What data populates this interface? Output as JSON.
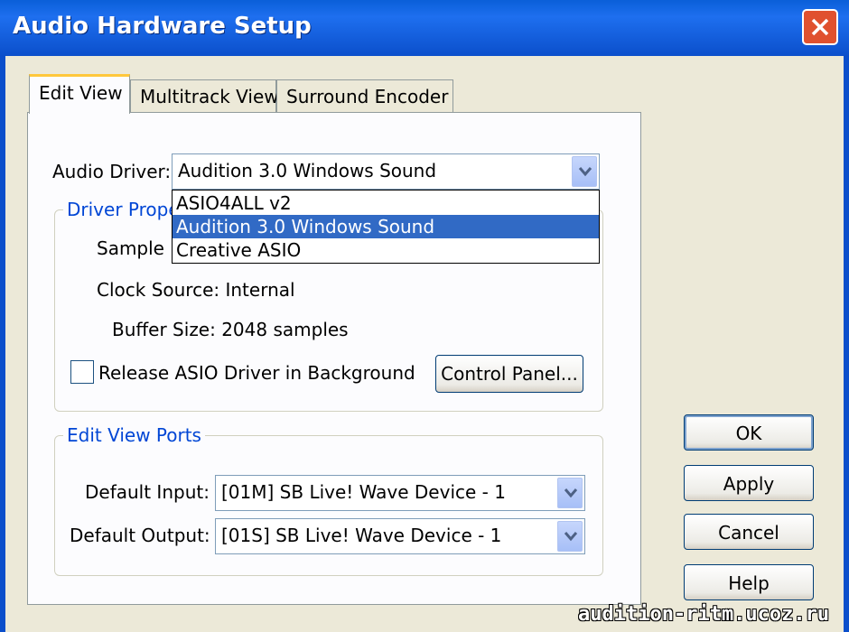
{
  "window": {
    "title": "Audio Hardware Setup"
  },
  "tabs": [
    {
      "label": "Edit View",
      "active": true
    },
    {
      "label": "Multitrack View",
      "active": false
    },
    {
      "label": "Surround Encoder",
      "active": false
    }
  ],
  "audio_driver": {
    "label": "Audio Driver:",
    "value": "Audition 3.0 Windows Sound",
    "options": [
      "ASIO4ALL v2",
      "Audition 3.0 Windows Sound",
      "Creative ASIO"
    ],
    "selected_option": "Audition 3.0 Windows Sound"
  },
  "driver_properties": {
    "group_title": "Driver Prope",
    "sample_rate_label": "Sample R",
    "clock_source": "Clock Source: Internal",
    "buffer_size": "Buffer Size: 2048 samples",
    "release_asio_label": "Release ASIO Driver in Background",
    "release_asio_checked": false,
    "control_panel_button": "Control Panel..."
  },
  "edit_view_ports": {
    "group_title": "Edit View Ports",
    "default_input_label": "Default Input:",
    "default_input_value": "[01M] SB Live! Wave Device - 1",
    "default_output_label": "Default Output:",
    "default_output_value": "[01S] SB Live! Wave Device - 1"
  },
  "buttons": {
    "ok": "OK",
    "apply": "Apply",
    "cancel": "Cancel",
    "help": "Help"
  },
  "watermark": "audition-ritm.ucoz.ru",
  "colors": {
    "titlebar": "#0B4FCB",
    "selection": "#316AC5",
    "group_title": "#0046D5",
    "tab_highlight": "#FFC83C"
  }
}
